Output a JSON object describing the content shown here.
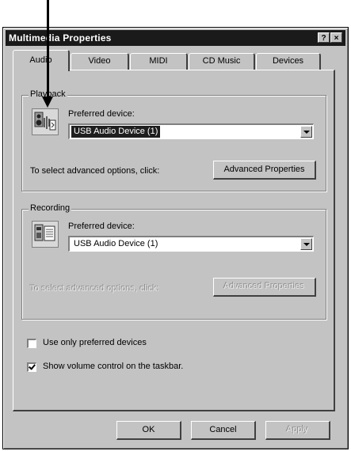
{
  "window": {
    "title": "Multimedia Properties",
    "help_btn": "?",
    "close_btn": "×"
  },
  "tabs": [
    {
      "label": "Audio",
      "active": true
    },
    {
      "label": "Video",
      "active": false
    },
    {
      "label": "MIDI",
      "active": false
    },
    {
      "label": "CD Music",
      "active": false
    },
    {
      "label": "Devices",
      "active": false
    }
  ],
  "playback": {
    "group_label": "Playback",
    "icon": "speaker-icon",
    "preferred_label": "Preferred device:",
    "device": "USB Audio Device (1)",
    "advanced_text": "To select advanced options, click:",
    "advanced_btn": "Advanced Properties"
  },
  "recording": {
    "group_label": "Recording",
    "icon": "microphone-icon",
    "preferred_label": "Preferred device:",
    "device": "USB Audio Device (1)",
    "advanced_text": "To select advanced options, click:",
    "advanced_btn": "Advanced Properties"
  },
  "options": {
    "use_preferred_only": {
      "label": "Use only preferred devices",
      "checked": false
    },
    "show_volume": {
      "label": "Show volume control on the taskbar.",
      "checked": true
    }
  },
  "buttons": {
    "ok": "OK",
    "cancel": "Cancel",
    "apply": "Apply"
  },
  "colors": {
    "face": "#c3c3c3",
    "titlebar": "#1a1a1a",
    "highlight": "#1e1e1e"
  }
}
